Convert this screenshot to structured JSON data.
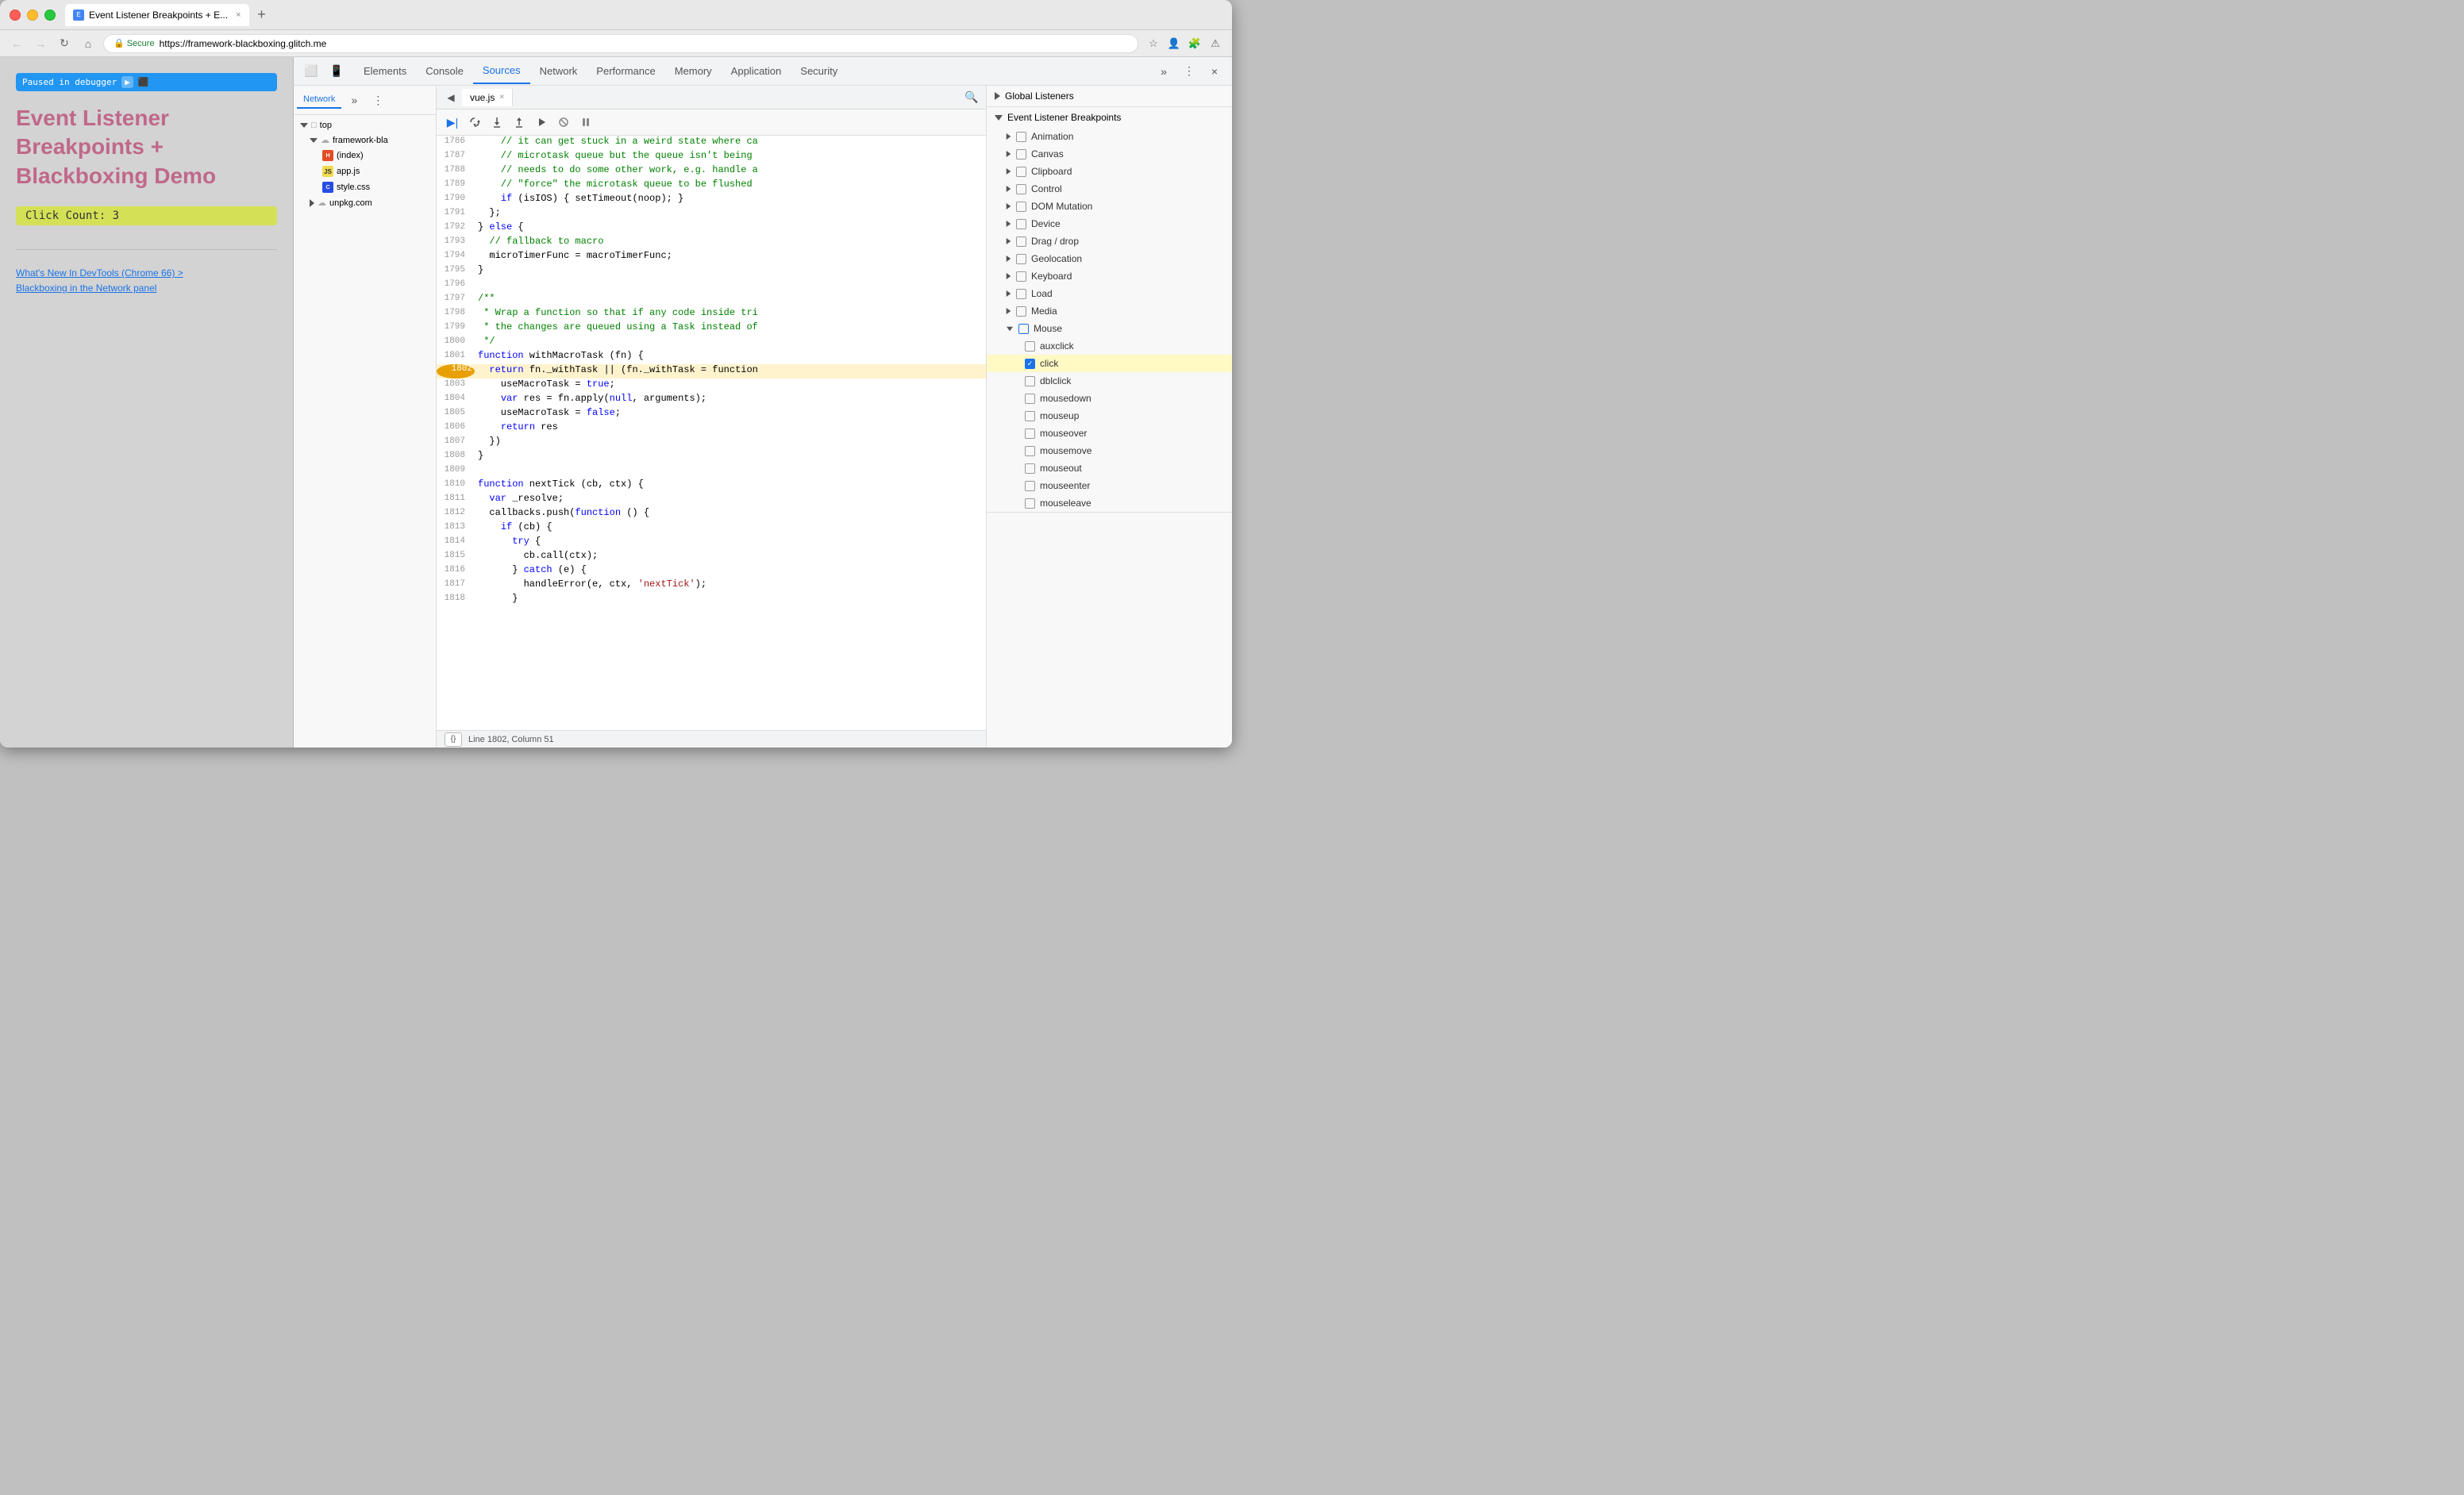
{
  "browser": {
    "tab_label": "Event Listener Breakpoints + E...",
    "tab_close": "×",
    "url": "https://framework-blackboxing.glitch.me",
    "secure_label": "Secure",
    "new_tab_label": "+"
  },
  "page_preview": {
    "paused_label": "Paused in debugger",
    "title_line1": "Event Listener",
    "title_line2": "Breakpoints +",
    "title_line3": "Blackboxing Demo",
    "click_count": "Click Count: 3",
    "link1": "What's New In DevTools (Chrome 66) >",
    "link2": "Blackboxing in the Network panel"
  },
  "devtools": {
    "tabs": [
      "Elements",
      "Console",
      "Sources",
      "Network",
      "Performance",
      "Memory",
      "Application",
      "Security"
    ],
    "active_tab": "Sources",
    "more_icon": "»",
    "close_icon": "×",
    "menu_icon": "⋮"
  },
  "sources": {
    "sidebar_tab": "Network",
    "more_btn": "»",
    "menu_btn": "⋮",
    "tree": {
      "top_label": "top",
      "framework_label": "framework-bla",
      "index_label": "(index)",
      "appjs_label": "app.js",
      "stylecss_label": "style.css",
      "unpkg_label": "unpkg.com"
    },
    "editor_tab": "vue.js",
    "editor_tab_close": "×"
  },
  "code_lines": [
    {
      "num": "1786",
      "content": "    // it can get stuck in a weird state where ca",
      "type": "comment"
    },
    {
      "num": "1787",
      "content": "    // microtask queue but the queue isn't being",
      "type": "comment"
    },
    {
      "num": "1788",
      "content": "    // needs to do some other work, e.g. handle a",
      "type": "comment"
    },
    {
      "num": "1789",
      "content": "    // \"force\" the microtask queue to be flushed",
      "type": "comment"
    },
    {
      "num": "1790",
      "content": "    if (isIOS) { setTimeout(noop); }",
      "type": "code"
    },
    {
      "num": "1791",
      "content": "  };",
      "type": "code"
    },
    {
      "num": "1792",
      "content": "} else {",
      "type": "code"
    },
    {
      "num": "1793",
      "content": "  // fallback to macro",
      "type": "comment"
    },
    {
      "num": "1794",
      "content": "  microTimerFunc = macroTimerFunc;",
      "type": "code"
    },
    {
      "num": "1795",
      "content": "}",
      "type": "code"
    },
    {
      "num": "1796",
      "content": "",
      "type": "code"
    },
    {
      "num": "1797",
      "content": "/**",
      "type": "comment"
    },
    {
      "num": "1798",
      "content": " * Wrap a function so that if any code inside tri",
      "type": "comment"
    },
    {
      "num": "1799",
      "content": " * the changes are queued using a Task instead of",
      "type": "comment"
    },
    {
      "num": "1800",
      "content": " */",
      "type": "comment"
    },
    {
      "num": "1801",
      "content": "function withMacroTask (fn) {",
      "type": "code"
    },
    {
      "num": "1802",
      "content": "  return fn._withTask || (fn._withTask = function",
      "type": "breakpoint"
    },
    {
      "num": "1803",
      "content": "    useMacroTask = true;",
      "type": "code"
    },
    {
      "num": "1804",
      "content": "    var res = fn.apply(null, arguments);",
      "type": "code"
    },
    {
      "num": "1805",
      "content": "    useMacroTask = false;",
      "type": "code"
    },
    {
      "num": "1806",
      "content": "    return res",
      "type": "code"
    },
    {
      "num": "1807",
      "content": "  })",
      "type": "code"
    },
    {
      "num": "1808",
      "content": "}",
      "type": "code"
    },
    {
      "num": "1809",
      "content": "",
      "type": "code"
    },
    {
      "num": "1810",
      "content": "function nextTick (cb, ctx) {",
      "type": "code"
    },
    {
      "num": "1811",
      "content": "  var _resolve;",
      "type": "code"
    },
    {
      "num": "1812",
      "content": "  callbacks.push(function () {",
      "type": "code"
    },
    {
      "num": "1813",
      "content": "    if (cb) {",
      "type": "code"
    },
    {
      "num": "1814",
      "content": "      try {",
      "type": "code"
    },
    {
      "num": "1815",
      "content": "        cb.call(ctx);",
      "type": "code"
    },
    {
      "num": "1816",
      "content": "      } catch (e) {",
      "type": "code"
    },
    {
      "num": "1817",
      "content": "        handleError(e, ctx, 'nextTick');",
      "type": "code"
    },
    {
      "num": "1818",
      "content": "      }",
      "type": "code"
    }
  ],
  "status_bar": {
    "format_label": "{}",
    "position": "Line 1802, Column 51"
  },
  "breakpoints": {
    "global_listeners_label": "Global Listeners",
    "event_listener_label": "Event Listener Breakpoints",
    "sections": [
      {
        "label": "Animation",
        "expanded": false,
        "checked": false
      },
      {
        "label": "Canvas",
        "expanded": false,
        "checked": false
      },
      {
        "label": "Clipboard",
        "expanded": false,
        "checked": false
      },
      {
        "label": "Control",
        "expanded": false,
        "checked": false
      },
      {
        "label": "DOM Mutation",
        "expanded": false,
        "checked": false
      },
      {
        "label": "Device",
        "expanded": false,
        "checked": false
      },
      {
        "label": "Drag / drop",
        "expanded": false,
        "checked": false
      },
      {
        "label": "Geolocation",
        "expanded": false,
        "checked": false
      },
      {
        "label": "Keyboard",
        "expanded": false,
        "checked": false
      },
      {
        "label": "Load",
        "expanded": false,
        "checked": false
      },
      {
        "label": "Media",
        "expanded": false,
        "checked": false
      },
      {
        "label": "Mouse",
        "expanded": true,
        "checked": false
      }
    ],
    "mouse_children": [
      {
        "label": "auxclick",
        "checked": false,
        "selected": false
      },
      {
        "label": "click",
        "checked": true,
        "selected": true
      },
      {
        "label": "dblclick",
        "checked": false,
        "selected": false
      },
      {
        "label": "mousedown",
        "checked": false,
        "selected": false
      },
      {
        "label": "mouseup",
        "checked": false,
        "selected": false
      },
      {
        "label": "mouseover",
        "checked": false,
        "selected": false
      },
      {
        "label": "mousemove",
        "checked": false,
        "selected": false
      },
      {
        "label": "mouseout",
        "checked": false,
        "selected": false
      },
      {
        "label": "mouseenter",
        "checked": false,
        "selected": false
      },
      {
        "label": "mouseleave",
        "checked": false,
        "selected": false
      }
    ]
  },
  "debugger_toolbar": {
    "resume_label": "Resume",
    "step_over_label": "Step over",
    "step_into_label": "Step into",
    "step_out_label": "Step out",
    "step_label": "Step",
    "deactivate_label": "Deactivate",
    "pause_label": "Pause on exceptions"
  },
  "colors": {
    "accent_blue": "#1a73e8",
    "breakpoint_yellow": "#fff3cd",
    "mouse_expand": "#333",
    "checked_blue": "#1a73e8"
  }
}
